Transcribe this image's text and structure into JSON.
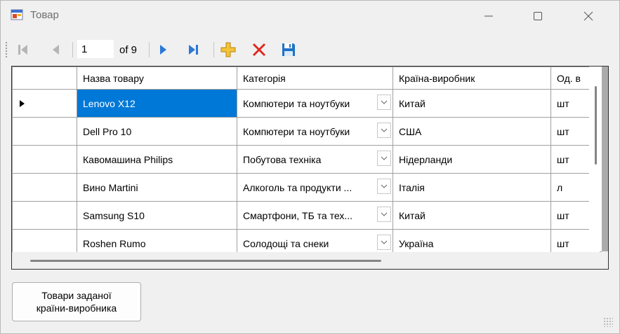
{
  "window": {
    "title": "Товар"
  },
  "navigator": {
    "position": "1",
    "count_label": "of 9"
  },
  "grid": {
    "columns": [
      "Назва товару",
      "Категорія",
      "Країна-виробник",
      "Од. в"
    ],
    "rows": [
      {
        "name": "Lenovo X12",
        "category": "Компютери та ноутбуки",
        "country": "Китай",
        "unit": "шт"
      },
      {
        "name": "Dell Pro 10",
        "category": "Компютери та ноутбуки",
        "country": "США",
        "unit": "шт"
      },
      {
        "name": "Кавомашина Philips",
        "category": "Побутова техніка",
        "country": "Нідерланди",
        "unit": "шт"
      },
      {
        "name": "Вино Martini",
        "category": "Алкоголь та продукти ...",
        "country": "Італія",
        "unit": "л"
      },
      {
        "name": "Samsung S10",
        "category": "Смартфони, ТБ та тех...",
        "country": "Китай",
        "unit": "шт"
      },
      {
        "name": "Roshen Rumo",
        "category": "Солодощі та снеки",
        "country": "Україна",
        "unit": "шт"
      }
    ]
  },
  "buttons": {
    "filter_by_country": "Товари заданої\nкраїни-виробника"
  },
  "colors": {
    "selection": "#0078d7",
    "nav_blue": "#2a78d6",
    "add_gold": "#e8b21f",
    "delete_red": "#e0251b"
  },
  "icons": [
    "form-icon",
    "move-first-icon",
    "move-previous-icon",
    "move-next-icon",
    "move-last-icon",
    "add-new-icon",
    "delete-icon",
    "save-icon",
    "minimize-icon",
    "maximize-icon",
    "close-icon"
  ]
}
